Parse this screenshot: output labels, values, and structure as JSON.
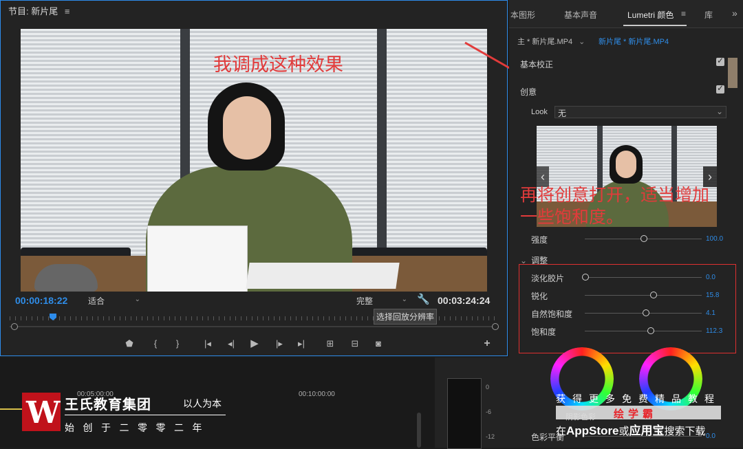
{
  "program_monitor": {
    "title": "节目: 新片尾",
    "menu_icon": "≡",
    "annotation": "我调成这种效果",
    "current_timecode": "00:00:18:22",
    "duration_timecode": "00:03:24:24",
    "zoom_value": "适合",
    "quality_value": "完整",
    "tooltip": "选择回放分辨率"
  },
  "timeline": {
    "time_label_1": "00:05:00:00",
    "time_label_2": "00:10:00:00",
    "meter_labels": [
      "0",
      "-6",
      "-12"
    ]
  },
  "logo": {
    "name": "王氏教育集团",
    "slogan": "以人为本",
    "founded": "始创于二零零二年"
  },
  "lumetri": {
    "tabs": [
      "本图形",
      "基本声音",
      "Lumetri 颜色",
      "库"
    ],
    "tab_menu_icon": "≡",
    "overflow_icon": "»",
    "clip_master": "主 * 新片尾.MP4",
    "clip_active": "新片尾 * 新片尾.MP4",
    "section_basic": "基本校正",
    "section_creative": "创意",
    "look_label": "Look",
    "look_value": "无",
    "annotation": "再将创意打开，适当增加一些饱和度。",
    "intensity": {
      "label": "强度",
      "value": "100.0",
      "fraction": 0.5
    },
    "adjust_label": "调整",
    "sliders": [
      {
        "label": "淡化胶片",
        "value": "0.0",
        "fraction": 0.0
      },
      {
        "label": "锐化",
        "value": "15.8",
        "fraction": 0.58
      },
      {
        "label": "自然饱和度",
        "value": "4.1",
        "fraction": 0.52
      },
      {
        "label": "饱和度",
        "value": "112.3",
        "fraction": 0.56
      }
    ],
    "shadow_tint_label": "阴影色彩",
    "color_balance": {
      "label": "色彩平衡",
      "value": "0.0"
    }
  },
  "ad": {
    "line1": "获得更多免费精品教程",
    "brand": "绘学霸",
    "line3_prefix": "在",
    "line3_store": "AppStore",
    "line3_mid": "或",
    "line3_app": "应用宝",
    "line3_suffix": "搜索下载"
  },
  "colors": {
    "accent": "#2d8ceb",
    "annotation": "#e23b3b",
    "highlight_box": "#e03030",
    "logo_red": "#c0121b"
  }
}
